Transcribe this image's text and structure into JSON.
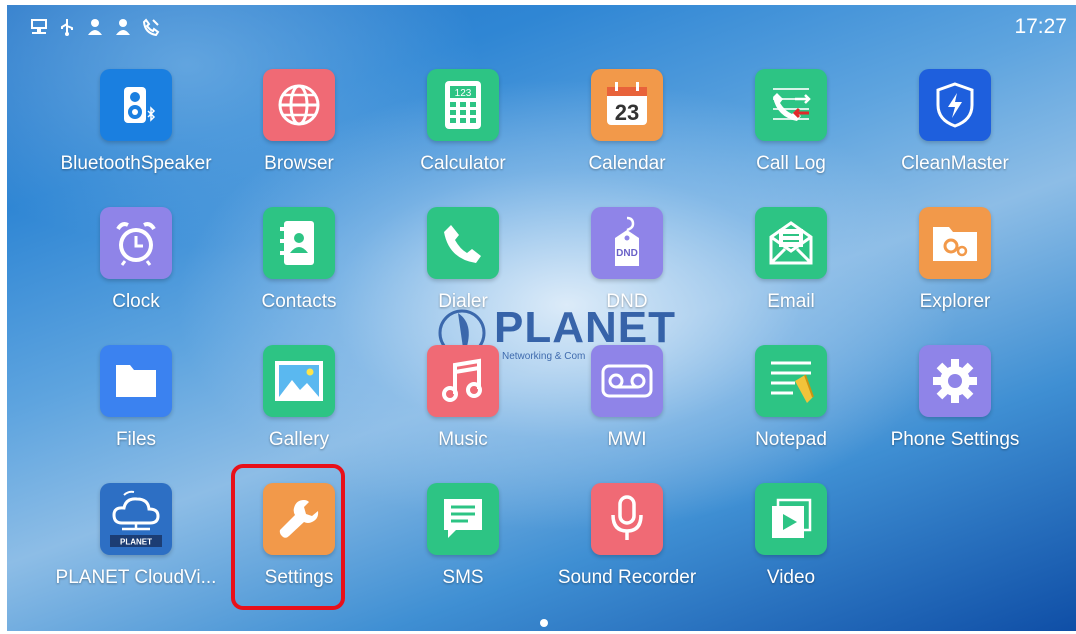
{
  "status_bar": {
    "icons": [
      "network-icon",
      "usb-icon",
      "user-icon",
      "user-icon",
      "missed-call-icon"
    ],
    "time": "17:27"
  },
  "apps": [
    {
      "label": "BluetoothSpeaker",
      "icon": "bluetooth-speaker-icon",
      "color": "#1a7fe0"
    },
    {
      "label": "Browser",
      "icon": "globe-icon",
      "color": "#f06a75"
    },
    {
      "label": "Calculator",
      "icon": "calculator-icon",
      "color": "#2dc484"
    },
    {
      "label": "Calendar",
      "icon": "calendar-icon",
      "color": "#f2994a",
      "text": "23"
    },
    {
      "label": "Call Log",
      "icon": "call-log-icon",
      "color": "#2dc484"
    },
    {
      "label": "CleanMaster",
      "icon": "shield-bolt-icon",
      "color": "#1e5fdd"
    },
    {
      "label": "Clock",
      "icon": "alarm-clock-icon",
      "color": "#8f84e8"
    },
    {
      "label": "Contacts",
      "icon": "contacts-book-icon",
      "color": "#2dc484"
    },
    {
      "label": "Dialer",
      "icon": "phone-icon",
      "color": "#2dc484"
    },
    {
      "label": "DND",
      "icon": "dnd-tag-icon",
      "color": "#8f84e8",
      "text": "DND"
    },
    {
      "label": "Email",
      "icon": "envelope-icon",
      "color": "#2dc484"
    },
    {
      "label": "Explorer",
      "icon": "folder-gears-icon",
      "color": "#f2994a"
    },
    {
      "label": "Files",
      "icon": "folder-icon",
      "color": "#3b82f0"
    },
    {
      "label": "Gallery",
      "icon": "picture-icon",
      "color": "#2dc484"
    },
    {
      "label": "Music",
      "icon": "music-note-icon",
      "color": "#f06a75"
    },
    {
      "label": "MWI",
      "icon": "voicemail-icon",
      "color": "#8f84e8"
    },
    {
      "label": "Notepad",
      "icon": "notepad-icon",
      "color": "#2dc484"
    },
    {
      "label": "Phone Settings",
      "icon": "gear-icon",
      "color": "#8f84e8"
    },
    {
      "label": "PLANET CloudVi...",
      "icon": "cloud-icon",
      "color": "#2d6fc4",
      "text": "PLANET"
    },
    {
      "label": "Settings",
      "icon": "wrench-icon",
      "color": "#f2994a"
    },
    {
      "label": "SMS",
      "icon": "message-icon",
      "color": "#2dc484"
    },
    {
      "label": "Sound Recorder",
      "icon": "microphone-icon",
      "color": "#f06a75"
    },
    {
      "label": "Video",
      "icon": "play-icon",
      "color": "#2dc484"
    }
  ],
  "watermark": {
    "title": "PLANET",
    "subtitle": "Networking & Com"
  },
  "highlight_color": "#e8101a"
}
